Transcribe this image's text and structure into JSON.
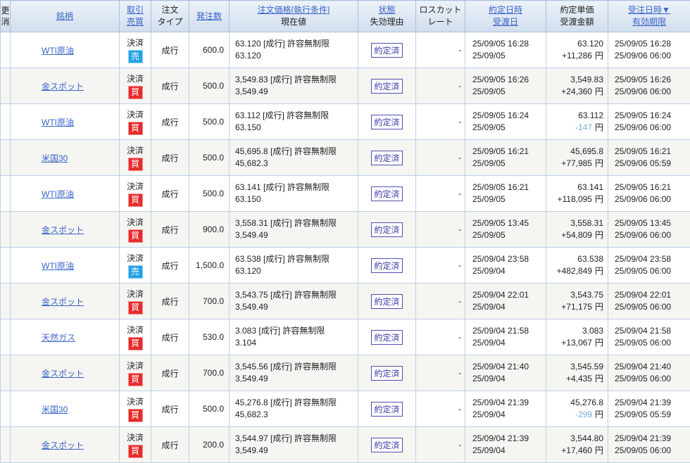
{
  "colors": {
    "link_blue": "#3a64c8",
    "buy_badge": "#e62b2b",
    "sell_badge": "#25a2e5",
    "status_badge": "#3d3da8",
    "negative_amount": "#74aede",
    "header_bg_top": "#ecf2f9",
    "header_bg_bottom": "#d2deee",
    "grid_border": "#bdd0e7",
    "zebra_row": "#f5f5f2"
  },
  "table": {
    "header": {
      "action_line1": "更",
      "action_line2": "消",
      "symbol": "銘柄",
      "trade1": "取引",
      "trade2": "売買",
      "otype1": "注文",
      "otype2": "タイプ",
      "qty": "発注数",
      "price1": "注文価格[執行条件]",
      "price2": "現在値",
      "status1": "状態",
      "status2": "失効理由",
      "loss1": "ロスカット",
      "loss2": "レート",
      "exec1": "約定日時",
      "exec2": "受渡日",
      "unit1": "約定単価",
      "unit2": "受渡金額",
      "order1": "受注日時▼",
      "order2": "有効期限"
    },
    "rows": [
      {
        "symbol": "WTI原油",
        "trade": "決済",
        "side": "売",
        "side_kind": "sell",
        "otype": "成行",
        "qty": "600.0",
        "price1": "63.120 [成行] 許容無制限",
        "price2": "63.120",
        "status": "約定済",
        "loss": "-",
        "exec1": "25/09/05 16:28",
        "exec2": "25/09/05",
        "unit_price": "63.120",
        "amount": "+11,286",
        "unit": "円",
        "neg": false,
        "order1": "25/09/05 16:28",
        "order2": "25/09/06 06:00"
      },
      {
        "symbol": "金スポット",
        "trade": "決済",
        "side": "買",
        "side_kind": "buy",
        "otype": "成行",
        "qty": "500.0",
        "price1": "3,549.83 [成行] 許容無制限",
        "price2": "3,549.49",
        "status": "約定済",
        "loss": "-",
        "exec1": "25/09/05 16:26",
        "exec2": "25/09/05",
        "unit_price": "3,549.83",
        "amount": "+24,360",
        "unit": "円",
        "neg": false,
        "order1": "25/09/05 16:26",
        "order2": "25/09/06 06:00"
      },
      {
        "symbol": "WTI原油",
        "trade": "決済",
        "side": "買",
        "side_kind": "buy",
        "otype": "成行",
        "qty": "500.0",
        "price1": "63.112 [成行] 許容無制限",
        "price2": "63.150",
        "status": "約定済",
        "loss": "-",
        "exec1": "25/09/05 16:24",
        "exec2": "25/09/05",
        "unit_price": "63.112",
        "amount": "-147",
        "unit": "円",
        "neg": true,
        "order1": "25/09/05 16:24",
        "order2": "25/09/06 06:00"
      },
      {
        "symbol": "米国30",
        "trade": "決済",
        "side": "買",
        "side_kind": "buy",
        "otype": "成行",
        "qty": "500.0",
        "price1": "45,695.8 [成行] 許容無制限",
        "price2": "45,682.3",
        "status": "約定済",
        "loss": "-",
        "exec1": "25/09/05 16:21",
        "exec2": "25/09/05",
        "unit_price": "45,695.8",
        "amount": "+77,985",
        "unit": "円",
        "neg": false,
        "order1": "25/09/05 16:21",
        "order2": "25/09/06 05:59"
      },
      {
        "symbol": "WTI原油",
        "trade": "決済",
        "side": "買",
        "side_kind": "buy",
        "otype": "成行",
        "qty": "500.0",
        "price1": "63.141 [成行] 許容無制限",
        "price2": "63.150",
        "status": "約定済",
        "loss": "-",
        "exec1": "25/09/05 16:21",
        "exec2": "25/09/05",
        "unit_price": "63.141",
        "amount": "+118,095",
        "unit": "円",
        "neg": false,
        "order1": "25/09/05 16:21",
        "order2": "25/09/06 06:00"
      },
      {
        "symbol": "金スポット",
        "trade": "決済",
        "side": "買",
        "side_kind": "buy",
        "otype": "成行",
        "qty": "900.0",
        "price1": "3,558.31 [成行] 許容無制限",
        "price2": "3,549.49",
        "status": "約定済",
        "loss": "-",
        "exec1": "25/09/05 13:45",
        "exec2": "25/09/05",
        "unit_price": "3,558.31",
        "amount": "+54,809",
        "unit": "円",
        "neg": false,
        "order1": "25/09/05 13:45",
        "order2": "25/09/06 06:00"
      },
      {
        "symbol": "WTI原油",
        "trade": "決済",
        "side": "売",
        "side_kind": "sell",
        "otype": "成行",
        "qty": "1,500.0",
        "price1": "63.538 [成行] 許容無制限",
        "price2": "63.120",
        "status": "約定済",
        "loss": "-",
        "exec1": "25/09/04 23:58",
        "exec2": "25/09/04",
        "unit_price": "63.538",
        "amount": "+482,849",
        "unit": "円",
        "neg": false,
        "order1": "25/09/04 23:58",
        "order2": "25/09/05 06:00"
      },
      {
        "symbol": "金スポット",
        "trade": "決済",
        "side": "買",
        "side_kind": "buy",
        "otype": "成行",
        "qty": "700.0",
        "price1": "3,543.75 [成行] 許容無制限",
        "price2": "3,549.49",
        "status": "約定済",
        "loss": "-",
        "exec1": "25/09/04 22:01",
        "exec2": "25/09/04",
        "unit_price": "3,543.75",
        "amount": "+71,175",
        "unit": "円",
        "neg": false,
        "order1": "25/09/04 22:01",
        "order2": "25/09/05 06:00"
      },
      {
        "symbol": "天然ガス",
        "trade": "決済",
        "side": "買",
        "side_kind": "buy",
        "otype": "成行",
        "qty": "530.0",
        "price1": "3.083 [成行] 許容無制限",
        "price2": "3.104",
        "status": "約定済",
        "loss": "-",
        "exec1": "25/09/04 21:58",
        "exec2": "25/09/04",
        "unit_price": "3.083",
        "amount": "+13,067",
        "unit": "円",
        "neg": false,
        "order1": "25/09/04 21:58",
        "order2": "25/09/05 06:00"
      },
      {
        "symbol": "金スポット",
        "trade": "決済",
        "side": "買",
        "side_kind": "buy",
        "otype": "成行",
        "qty": "700.0",
        "price1": "3,545.56 [成行] 許容無制限",
        "price2": "3,549.49",
        "status": "約定済",
        "loss": "-",
        "exec1": "25/09/04 21:40",
        "exec2": "25/09/04",
        "unit_price": "3,545.59",
        "amount": "+4,435",
        "unit": "円",
        "neg": false,
        "order1": "25/09/04 21:40",
        "order2": "25/09/05 06:00"
      },
      {
        "symbol": "米国30",
        "trade": "決済",
        "side": "買",
        "side_kind": "buy",
        "otype": "成行",
        "qty": "500.0",
        "price1": "45,276.8 [成行] 許容無制限",
        "price2": "45,682.3",
        "status": "約定済",
        "loss": "-",
        "exec1": "25/09/04 21:39",
        "exec2": "25/09/04",
        "unit_price": "45,276.8",
        "amount": "-299",
        "unit": "円",
        "neg": true,
        "order1": "25/09/04 21:39",
        "order2": "25/09/05 05:59"
      },
      {
        "symbol": "金スポット",
        "trade": "決済",
        "side": "買",
        "side_kind": "buy",
        "otype": "成行",
        "qty": "200.0",
        "price1": "3,544.97 [成行] 許容無制限",
        "price2": "3,549.49",
        "status": "約定済",
        "loss": "-",
        "exec1": "25/09/04 21:39",
        "exec2": "25/09/04",
        "unit_price": "3,544.80",
        "amount": "+17,460",
        "unit": "円",
        "neg": false,
        "order1": "25/09/04 21:39",
        "order2": "25/09/05 06:00"
      }
    ]
  }
}
